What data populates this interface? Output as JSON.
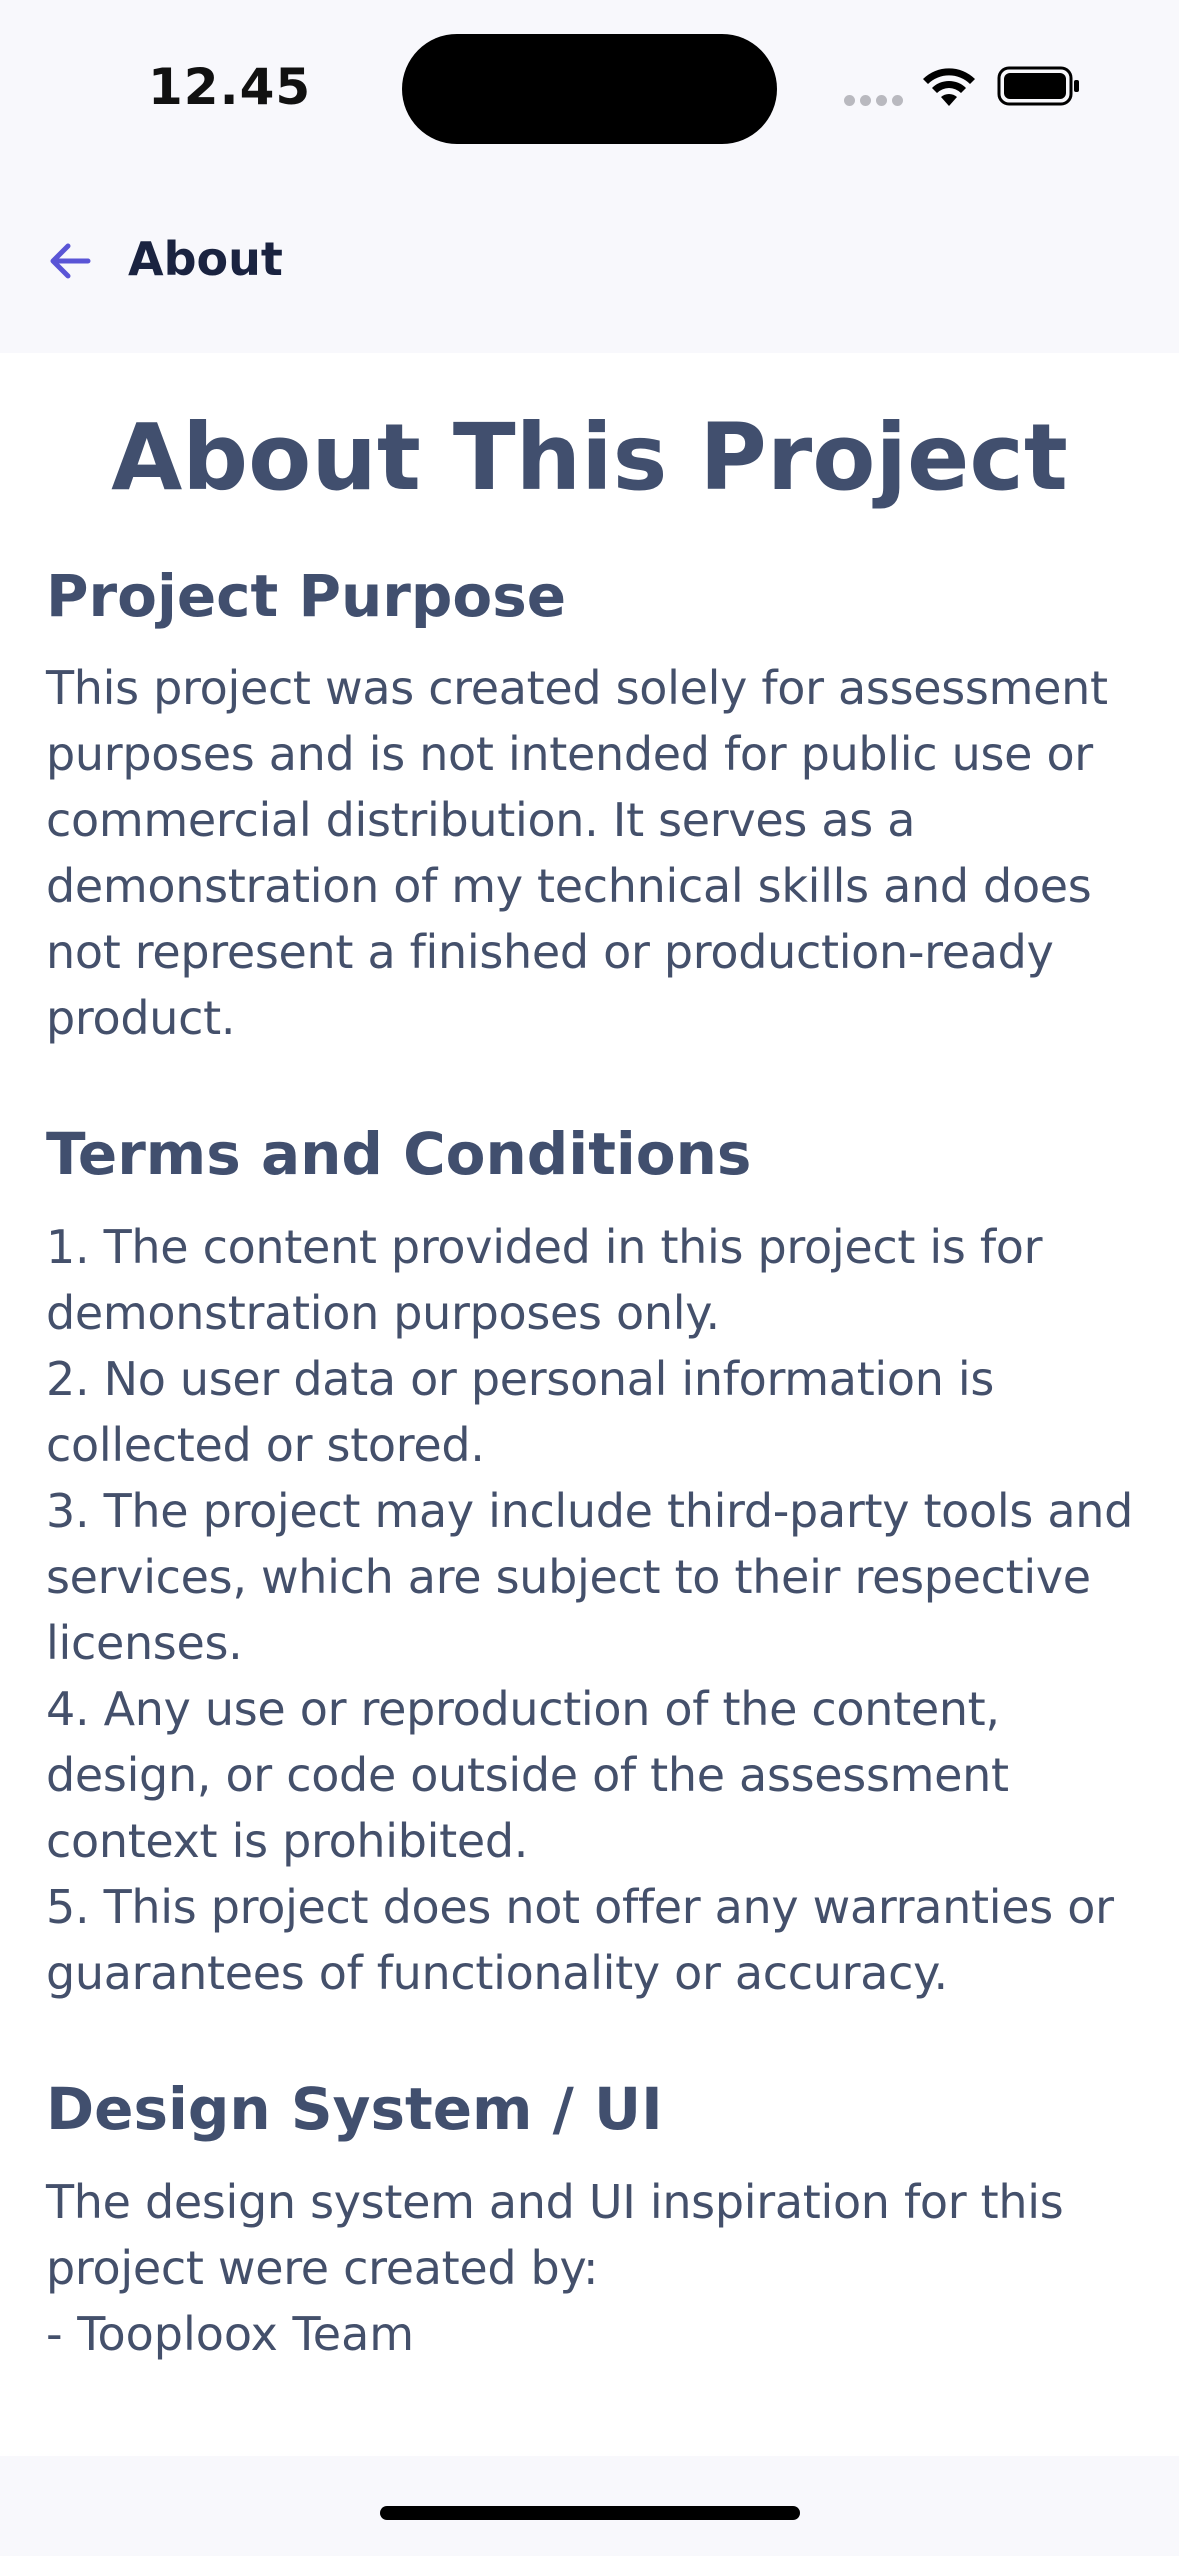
{
  "status_bar": {
    "time": "12.45",
    "icons": [
      "cellular-signal-icon",
      "wifi-icon",
      "battery-icon"
    ]
  },
  "header": {
    "back_icon": "arrow-left-icon",
    "title": "About"
  },
  "colors": {
    "accent": "#5a55d6",
    "heading": "#414f6e",
    "body_text": "#44506b",
    "nav_title": "#1a2340",
    "bar_background": "#f8f8fc"
  },
  "page": {
    "title": "About This Project",
    "sections": [
      {
        "heading": "Project Purpose",
        "body": "This project was created solely for assessment purposes and is not intended for public use or commercial distribution. It serves as a demonstration of my technical skills and does not represent a finished or production-ready product."
      },
      {
        "heading": "Terms and Conditions",
        "items": [
          "1. The content provided in this project is for demonstration purposes only.",
          "2. No user data or personal information is collected or stored.",
          "3. The project may include third-party tools and services, which are subject to their respective licenses.",
          "4. Any use or reproduction of the content, design, or code outside of the assessment context is prohibited.",
          "5. This project does not offer any warranties or guarantees of functionality or accuracy."
        ]
      },
      {
        "heading": "Design System / UI",
        "body": "The design system and UI inspiration for this project were created by:",
        "credits": [
          "- Tooploox Team"
        ]
      }
    ]
  }
}
